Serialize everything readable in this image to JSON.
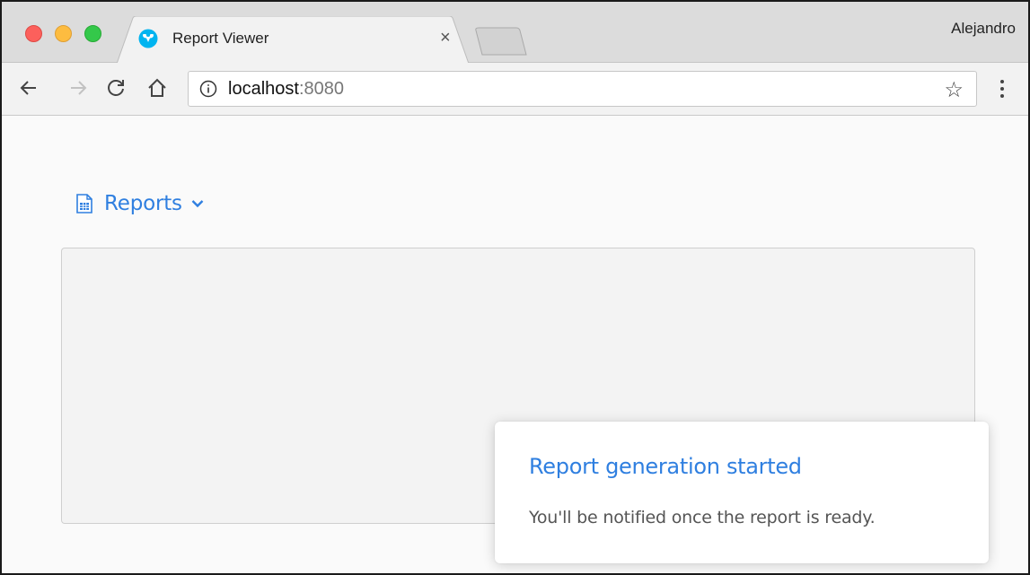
{
  "browser": {
    "tab": {
      "title": "Report Viewer",
      "close_label": "×",
      "favicon": "vaadin-logo-icon"
    },
    "profile_name": "Alejandro",
    "address": {
      "host": "localhost",
      "port": ":8080"
    },
    "icons": {
      "back": "arrow-left-icon",
      "forward": "arrow-right-icon",
      "reload": "reload-icon",
      "home": "home-icon",
      "info": "info-icon",
      "bookmark": "star-icon",
      "menu": "kebab-menu-icon"
    },
    "colors": {
      "close": "#fc605c",
      "minimize": "#fdbc40",
      "maximize": "#34c84a"
    }
  },
  "page": {
    "reports_menu": {
      "label": "Reports",
      "icon": "document-icon",
      "caret": "chevron-down-icon"
    },
    "notification": {
      "title": "Report generation started",
      "message": "You'll be notified once the report is ready."
    },
    "accent_color": "#2f7fe0"
  }
}
